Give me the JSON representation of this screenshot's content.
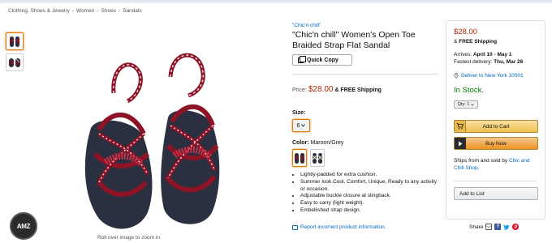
{
  "breadcrumb": [
    "Clothing, Shoes & Jewelry",
    "Women",
    "Shoes",
    "Sandals"
  ],
  "breadcrumb_separator": "›",
  "product": {
    "brand_link": "\"Chic'n chill\"",
    "title": "\"Chic'n chill\" Women's Open Toe Braided Strap Flat Sandal",
    "quick_copy_label": "Quick Copy",
    "price_label": "Price:",
    "price": "$28.00",
    "price_suffix": "& FREE Shipping",
    "size_label": "Size:",
    "size_value": "6",
    "color_label": "Color:",
    "color_value": "Maroon/Grey",
    "bullets": [
      "Lightly-padded for extra cushion.",
      "Summer look.Cool, Comfort, Unique, Ready to any activity or occasion.",
      "Adjustable buckle closure at slingback.",
      "Easy to carry (light weight).",
      "Embellished strap design."
    ],
    "report_link": "Report incorrect product information.",
    "zoom_hint": "Roll over image to zoom in"
  },
  "logo_text": "AMZ",
  "buybox": {
    "price": "$28.00",
    "free_prefix": "&",
    "free_shipping": "FREE Shipping",
    "arrives_label": "Arrives:",
    "arrives_dates": "April 10 - May 1",
    "fastest_label": "Fastest delivery:",
    "fastest_date": "Thu, Mar 26",
    "deliver_to": "Deliver to New York 10001",
    "stock": "In Stock.",
    "qty_label": "Qty: 1",
    "add_to_cart": "Add to Cart",
    "buy_now": "Buy Now",
    "ships_from_text": "Ships from and sold by",
    "seller": "Chic and Chill Shop.",
    "add_to_list": "Add to List"
  },
  "share_label": "Share",
  "colors": {
    "price": "#b12704",
    "link": "#0066c0",
    "in_stock": "#007600",
    "cart_button": "#f0c14b",
    "buy_button": "#ed9220",
    "sandal_strap": "#8e1326"
  }
}
